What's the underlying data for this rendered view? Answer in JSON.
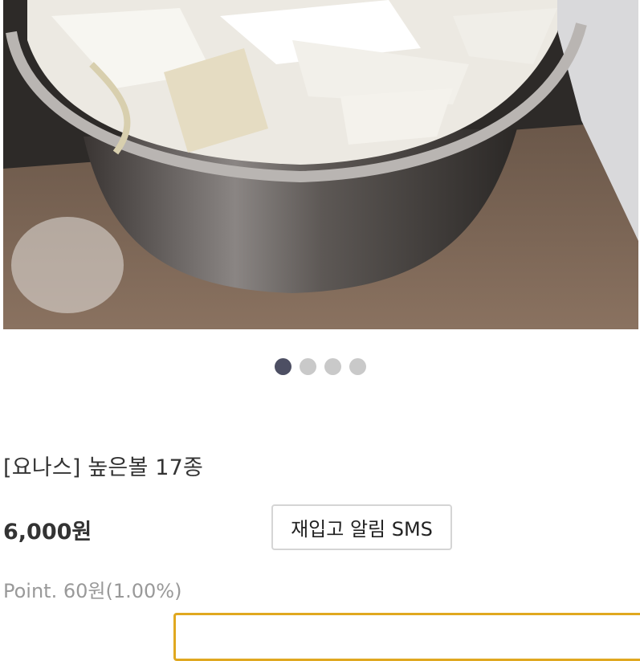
{
  "product": {
    "title": "[요나스] 높은볼 17종",
    "price": "6,000원",
    "point": "Point. 60원(1.00%)",
    "restock_button_label": "재입고 알림 SMS",
    "option_label": "",
    "option_selected": ""
  },
  "carousel": {
    "slide_count": 4,
    "active_index": 0
  },
  "colors": {
    "active_dot": "#4d4f63",
    "inactive_dot": "#c9c9c9",
    "select_border": "#e0a820"
  }
}
